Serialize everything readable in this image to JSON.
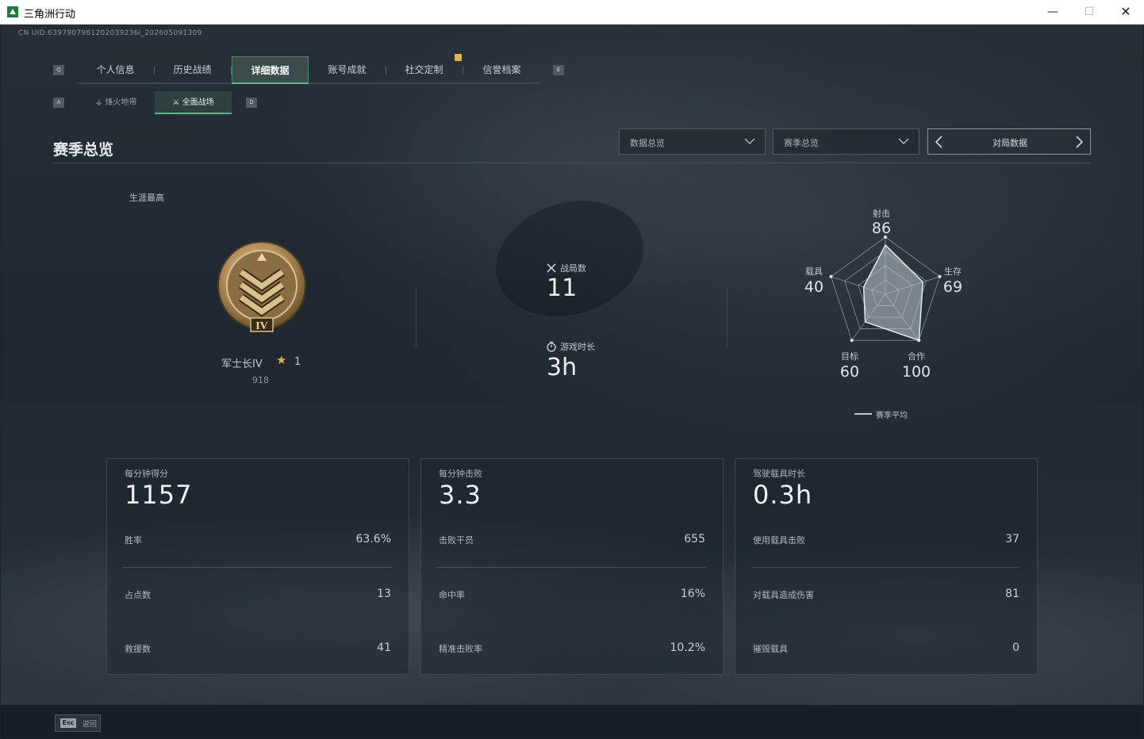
{
  "window": {
    "title": "三角洲行动",
    "minimize": "—",
    "maximize": "☐",
    "close": "✕"
  },
  "uid": "CN UID:6397907981202039236l_202605091309",
  "tabs": {
    "left_key": "Q",
    "right_key": "E",
    "items": [
      {
        "label": "个人信息"
      },
      {
        "label": "历史战绩"
      },
      {
        "label": "详细数据"
      },
      {
        "label": "账号成就"
      },
      {
        "label": "社交定制"
      },
      {
        "label": "信誉档案"
      }
    ],
    "active_index": 2
  },
  "subtabs": {
    "left_key": "A",
    "right_key": "D",
    "items": [
      {
        "label": "烽火地带",
        "icon": "flame-zone-icon"
      },
      {
        "label": "全面战场",
        "icon": "battlefield-icon"
      }
    ],
    "active_index": 1
  },
  "section": {
    "title": "赛季总览",
    "dropdown1": "数据总览",
    "dropdown2": "赛季总览",
    "pager_label": "对局数据"
  },
  "rank": {
    "career_label": "生涯最高",
    "badge_numeral": "IV",
    "name": "军士长IV",
    "stars": "1",
    "points": "918"
  },
  "summary": {
    "matches_label": "战局数",
    "matches_value": "11",
    "playtime_label": "游戏时长",
    "playtime_value": "3h"
  },
  "radar": {
    "labels": {
      "shooting": "射击",
      "survival": "生存",
      "cooperation": "合作",
      "objective": "目标",
      "vehicle": "载具"
    },
    "values": {
      "shooting": "86",
      "survival": "69",
      "cooperation": "100",
      "objective": "60",
      "vehicle": "40"
    },
    "legend": "赛季平均"
  },
  "cards": [
    {
      "title": "每分钟得分",
      "value": "1157",
      "rows": [
        {
          "label": "胜率",
          "value": "63.6%"
        },
        {
          "label": "占点数",
          "value": "13"
        },
        {
          "label": "救援数",
          "value": "41"
        }
      ]
    },
    {
      "title": "每分钟击败",
      "value": "3.3",
      "rows": [
        {
          "label": "击败干员",
          "value": "655"
        },
        {
          "label": "命中率",
          "value": "16%"
        },
        {
          "label": "精准击败率",
          "value": "10.2%"
        }
      ]
    },
    {
      "title": "驾驶载具时长",
      "value": "0.3h",
      "rows": [
        {
          "label": "使用载具击败",
          "value": "37"
        },
        {
          "label": "对载具造成伤害",
          "value": "81"
        },
        {
          "label": "摧毁载具",
          "value": "0"
        }
      ]
    }
  ],
  "footer": {
    "esc_key": "Esc",
    "back_label": "返回"
  },
  "colors": {
    "accent": "#5fb88a",
    "badge_gold": "#c9a66b",
    "star": "#d9b35c"
  }
}
